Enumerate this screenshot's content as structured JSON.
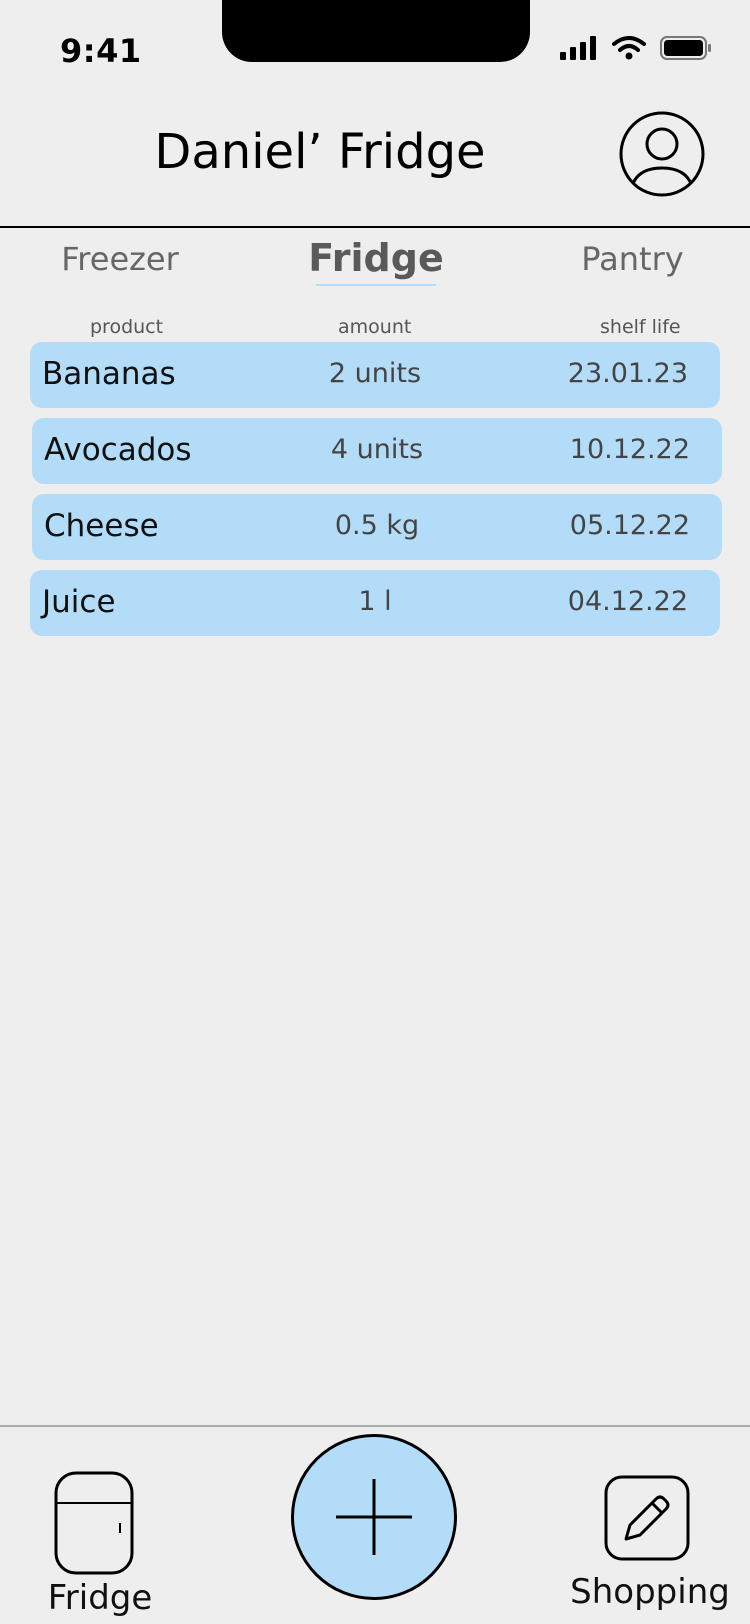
{
  "status_bar": {
    "time": "9:41"
  },
  "header": {
    "title": "Daniel’ Fridge"
  },
  "tabs": [
    {
      "label": "Freezer",
      "active": false
    },
    {
      "label": "Fridge",
      "active": true
    },
    {
      "label": "Pantry",
      "active": false
    }
  ],
  "columns": {
    "product": "product",
    "amount": "amount",
    "shelf_life": "shelf life"
  },
  "items": [
    {
      "product": "Bananas",
      "amount": "2 units",
      "shelf_life": "23.01.23"
    },
    {
      "product": "Avocados",
      "amount": "4 units",
      "shelf_life": "10.12.22"
    },
    {
      "product": "Cheese",
      "amount": "0.5 kg",
      "shelf_life": "05.12.22"
    },
    {
      "product": "Juice",
      "amount": "1 l",
      "shelf_life": "04.12.22"
    }
  ],
  "bottom_nav": {
    "fridge_label": "Fridge",
    "shopping_label": "Shopping"
  },
  "icons": {
    "avatar": "user-circle-icon",
    "fridge": "fridge-icon",
    "add": "plus-icon",
    "shopping": "pencil-edit-icon"
  },
  "colors": {
    "background": "#eeeeee",
    "accent": "#b3dcf9",
    "text": "#111111"
  }
}
